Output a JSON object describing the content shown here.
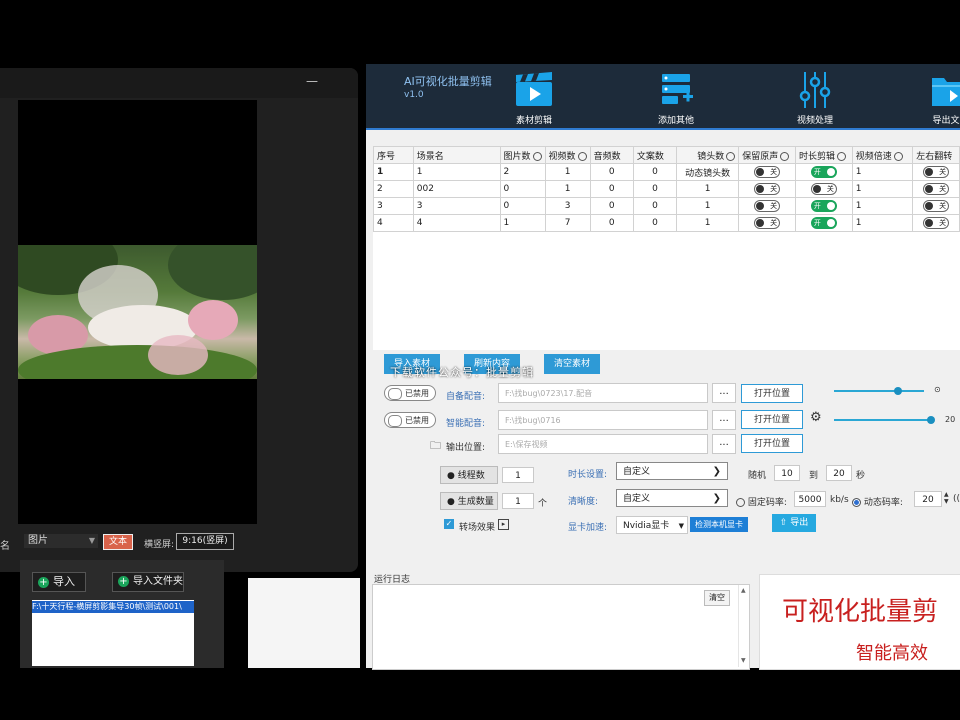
{
  "preview": {
    "bottom": {
      "ming_label": "名",
      "media_type": "图片",
      "text_button": "文本",
      "orientation_label": "横竖屏:",
      "orientation_value": "9:16(竖屏)"
    }
  },
  "import_panel": {
    "import_label": "导入",
    "import_folder_label": "导入文件夹",
    "file_path": "F:\\十天行程-横屏剪影集导30帧\\测试\\001\\"
  },
  "app": {
    "title": "AI可视化批量剪辑",
    "version": "v1.0",
    "nav": [
      {
        "label": "素材剪辑",
        "icon": "clapperboard-icon"
      },
      {
        "label": "添加其他",
        "icon": "add-list-icon"
      },
      {
        "label": "视频处理",
        "icon": "sliders-icon"
      },
      {
        "label": "导出文",
        "icon": "folder-export-icon"
      }
    ],
    "table": {
      "headers": [
        "序号",
        "场景名",
        "图片数",
        "视频数",
        "音频数",
        "文案数",
        "镜头数",
        "保留原声",
        "时长剪辑",
        "视频倍速",
        "左右翻转"
      ],
      "rows": [
        {
          "idx": "1",
          "scene": "1",
          "pics": "2",
          "videos": "1",
          "audio": "0",
          "text": "0",
          "shots": "动态镜头数",
          "keep": "关",
          "dur": "开",
          "speed": "1",
          "flip": "关"
        },
        {
          "idx": "2",
          "scene": "002",
          "pics": "0",
          "videos": "1",
          "audio": "0",
          "text": "0",
          "shots": "1",
          "keep": "关",
          "dur": "关",
          "speed": "1",
          "flip": "关"
        },
        {
          "idx": "3",
          "scene": "3",
          "pics": "0",
          "videos": "3",
          "audio": "0",
          "text": "0",
          "shots": "1",
          "keep": "关",
          "dur": "开",
          "speed": "1",
          "flip": "关"
        },
        {
          "idx": "4",
          "scene": "4",
          "pics": "1",
          "videos": "7",
          "audio": "0",
          "text": "0",
          "shots": "1",
          "keep": "关",
          "dur": "开",
          "speed": "1",
          "flip": "关"
        }
      ]
    },
    "buttons": {
      "import_material": "导入素材",
      "refresh": "刷新内容",
      "clear_material": "清空素材",
      "overlay_text": "下载软件公众号：批量剪辑"
    },
    "config": {
      "disabled_label": "已禁用",
      "custom_audio_label": "自备配音:",
      "custom_audio_path": "F:\\找bug\\0723\\17.配音",
      "smart_audio_label": "智能配音:",
      "smart_audio_path": "F:\\找bug\\0716",
      "output_label": "输出位置:",
      "output_path": "E:\\保存视频",
      "dots": "...",
      "open_location": "打开位置",
      "volume_2": "20"
    },
    "settings": {
      "threads_label": "线程数",
      "threads_value": "1",
      "count_label": "生成数量",
      "count_value": "1",
      "count_unit": "个",
      "transition_label": "转场效果",
      "duration_label": "时长设置:",
      "duration_value": "自定义",
      "clarity_label": "清晰度:",
      "clarity_value": "自定义",
      "gpu_label": "显卡加速:",
      "gpu_value": "Nvidia显卡",
      "detect_gpu": "检测本机显卡",
      "random_label": "随机",
      "random_min": "10",
      "to_label": "到",
      "random_max": "20",
      "sec_label": "秒",
      "fixed_bitrate_label": "固定码率:",
      "fixed_bitrate_value": "5000",
      "kbps_label": "kb/s",
      "dynamic_bitrate_label": "动态码率:",
      "dynamic_bitrate_value": "20",
      "export_label": "导出",
      "paren": "(("
    },
    "log": {
      "label": "运行日志",
      "clear": "清空"
    },
    "promo": {
      "line1": "可视化批量剪",
      "line2": "智能高效"
    }
  }
}
